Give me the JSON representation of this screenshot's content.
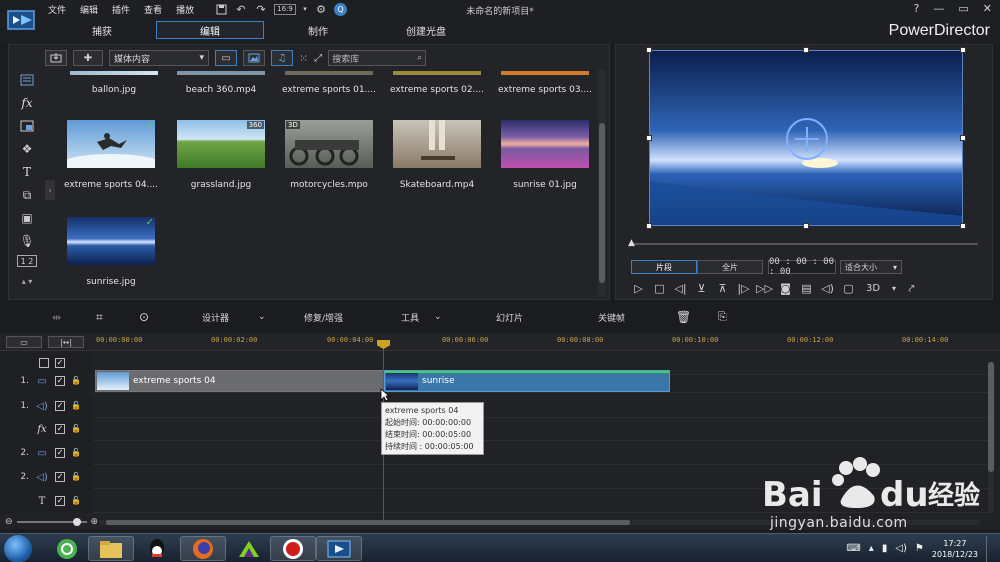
{
  "titlebar": {
    "menu": [
      "文件",
      "编辑",
      "插件",
      "查看",
      "播放"
    ],
    "window_title": "未命名的新项目*",
    "brand": "PowerDirector",
    "help": "?",
    "minimize": "—",
    "restore": "▭",
    "close": "✕",
    "ratio_label": "16:9",
    "badge": "Q",
    "modes": [
      {
        "label": "捕获",
        "active": false
      },
      {
        "label": "编辑",
        "active": true
      },
      {
        "label": "制作",
        "active": false
      },
      {
        "label": "创建光盘",
        "active": false
      }
    ]
  },
  "library": {
    "dropdown": "媒体内容",
    "search_placeholder": "搜索库",
    "row0": [
      "ballon.jpg",
      "beach 360.mp4",
      "extreme sports 01....",
      "extreme sports 02....",
      "extreme sports 03...."
    ],
    "items": [
      {
        "label": "extreme sports 04....",
        "check": "✓",
        "badge": ""
      },
      {
        "label": "grassland.jpg",
        "check": "",
        "badge": "360"
      },
      {
        "label": "motorcycles.mpo",
        "check": "",
        "badge": "3D"
      },
      {
        "label": "Skateboard.mp4",
        "check": "",
        "badge": ""
      },
      {
        "label": "sunrise 01.jpg",
        "check": "",
        "badge": ""
      },
      {
        "label": "sunrise.jpg",
        "check": "✓",
        "badge": ""
      }
    ]
  },
  "preview": {
    "tab_clip": "片段",
    "tab_movie": "全片",
    "timecode": "00 : 00 : 00 : 00",
    "fit": "适合大小",
    "stereo": "3D"
  },
  "timeline_toolbar": {
    "designer": "设计器",
    "fix": "修复/增强",
    "tools": "工具",
    "slideshow": "幻灯片",
    "keyframe": "关键帧"
  },
  "timeline": {
    "ticks": [
      "00:00:00:00",
      "00:00:02:00",
      "00:00:04:00",
      "00:00:06:00",
      "00:00:08:00",
      "00:00:10:00",
      "00:00:12:00",
      "00:00:14:00"
    ],
    "tracks": [
      {
        "num": "",
        "icon": "",
        "lock": false
      },
      {
        "num": "1.",
        "icon": "▭",
        "lock": true
      },
      {
        "num": "1.",
        "icon": "◁)",
        "lock": true
      },
      {
        "num": "",
        "icon": "fx",
        "lock": true
      },
      {
        "num": "2.",
        "icon": "▭",
        "lock": true
      },
      {
        "num": "2.",
        "icon": "◁)",
        "lock": true
      },
      {
        "num": "",
        "icon": "T",
        "lock": true
      }
    ],
    "clips": [
      {
        "name": "extreme sports 04"
      },
      {
        "name": "sunrise"
      }
    ],
    "tooltip": {
      "title": "extreme sports 04",
      "start": "起始时间: 00:00:00:00",
      "end": "结束时间: 00:00:05:00",
      "duration": "持续时间 :  00:00:05:00"
    }
  },
  "taskbar": {
    "time": "17:27",
    "date": "2018/12/23"
  },
  "watermark": {
    "url": "jingyan.baidu.com"
  }
}
